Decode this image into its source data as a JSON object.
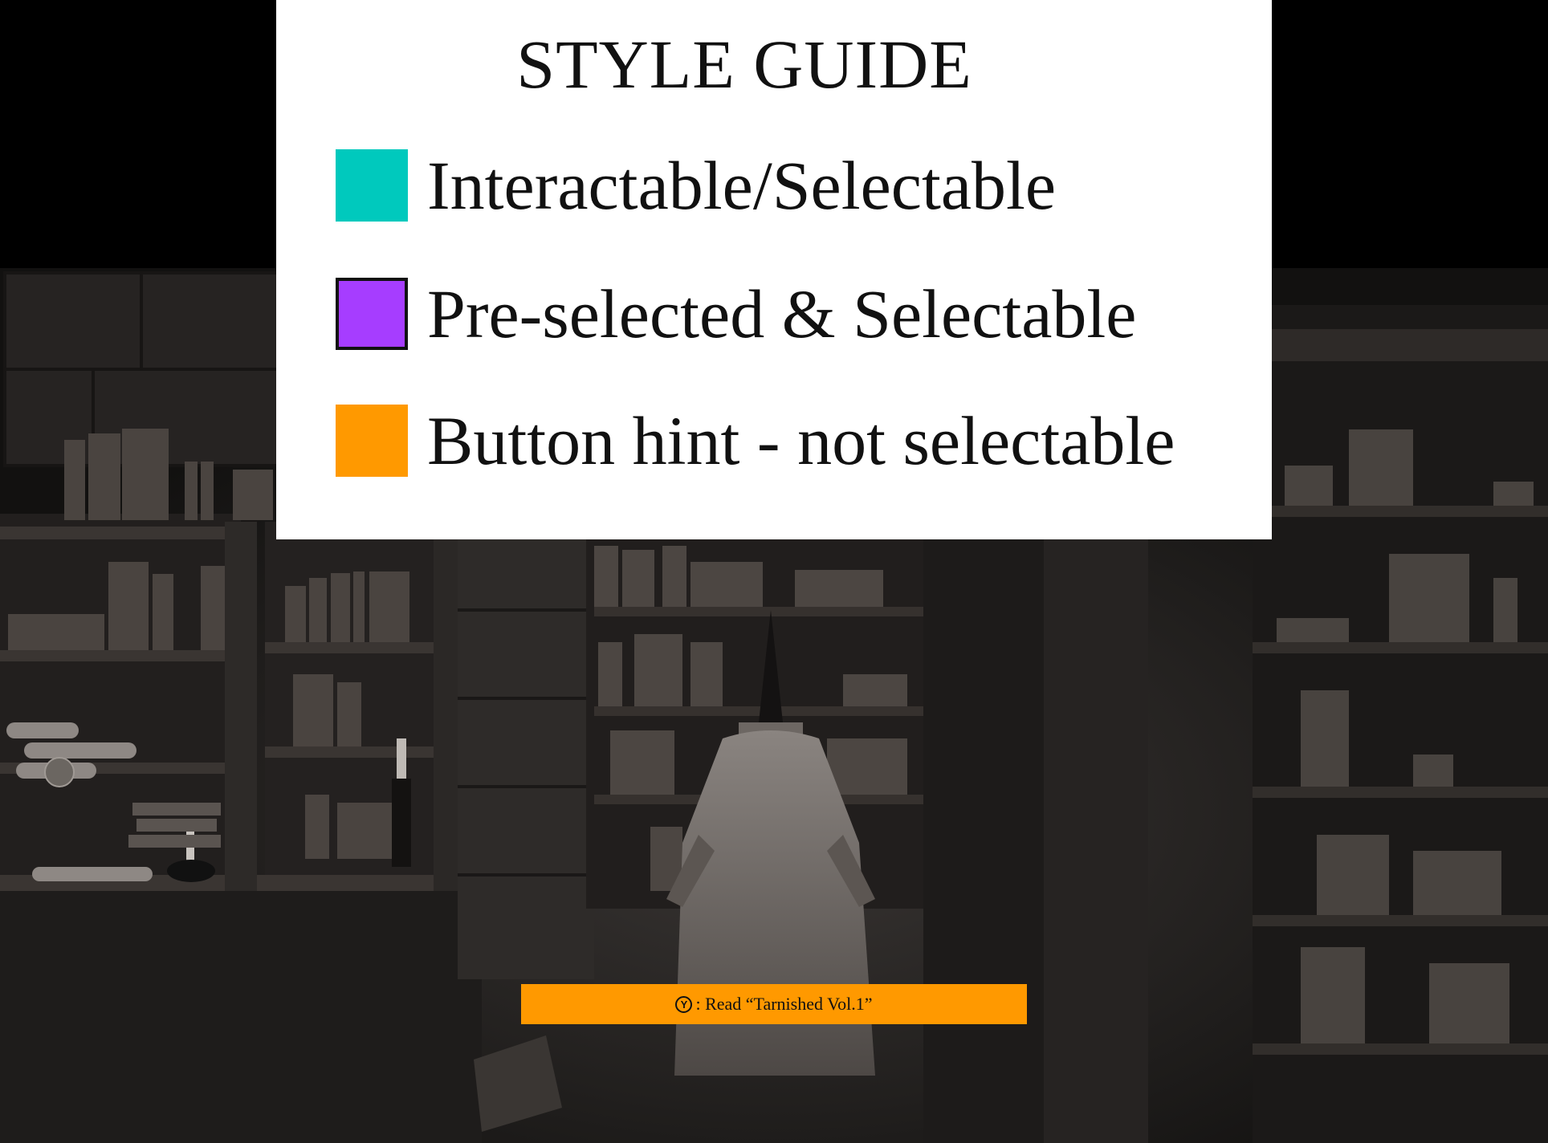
{
  "style_guide": {
    "title": "STYLE GUIDE",
    "items": [
      {
        "color": "#00C9BD",
        "label": "Interactable/Selectable"
      },
      {
        "color": "#A63DFF",
        "label": "Pre-selected & Selectable"
      },
      {
        "color": "#FF9900",
        "label": "Button hint - not selectable"
      }
    ]
  },
  "button_hint": {
    "button_letter": "Y",
    "text": ": Read “Tarnished Vol.1”",
    "color": "#FF9900"
  },
  "colors": {
    "background": "#000000",
    "panel": "#FFFFFF",
    "shelf_dark": "#1c1a19",
    "shelf_mid": "#2e2a27",
    "book_light": "#5a5450"
  }
}
